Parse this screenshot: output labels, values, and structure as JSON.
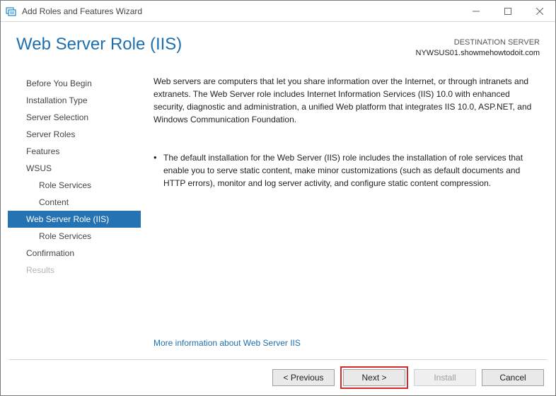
{
  "window": {
    "title": "Add Roles and Features Wizard"
  },
  "header": {
    "title": "Web Server Role (IIS)",
    "destination_label": "DESTINATION SERVER",
    "destination_server": "NYWSUS01.showmehowtodoit.com"
  },
  "nav": {
    "items": [
      {
        "label": "Before You Begin",
        "sub": false,
        "selected": false,
        "disabled": false
      },
      {
        "label": "Installation Type",
        "sub": false,
        "selected": false,
        "disabled": false
      },
      {
        "label": "Server Selection",
        "sub": false,
        "selected": false,
        "disabled": false
      },
      {
        "label": "Server Roles",
        "sub": false,
        "selected": false,
        "disabled": false
      },
      {
        "label": "Features",
        "sub": false,
        "selected": false,
        "disabled": false
      },
      {
        "label": "WSUS",
        "sub": false,
        "selected": false,
        "disabled": false
      },
      {
        "label": "Role Services",
        "sub": true,
        "selected": false,
        "disabled": false
      },
      {
        "label": "Content",
        "sub": true,
        "selected": false,
        "disabled": false
      },
      {
        "label": "Web Server Role (IIS)",
        "sub": false,
        "selected": true,
        "disabled": false
      },
      {
        "label": "Role Services",
        "sub": true,
        "selected": false,
        "disabled": false
      },
      {
        "label": "Confirmation",
        "sub": false,
        "selected": false,
        "disabled": false
      },
      {
        "label": "Results",
        "sub": false,
        "selected": false,
        "disabled": true
      }
    ]
  },
  "content": {
    "intro": "Web servers are computers that let you share information over the Internet, or through intranets and extranets. The Web Server role includes Internet Information Services (IIS) 10.0 with enhanced security, diagnostic and administration, a unified Web platform that integrates IIS 10.0, ASP.NET, and Windows Communication Foundation.",
    "bullet1": "The default installation for the Web Server (IIS) role includes the installation of role services that enable you to serve static content, make minor customizations (such as default documents and HTTP errors), monitor and log server activity, and configure static content compression.",
    "more_link": "More information about Web Server IIS"
  },
  "footer": {
    "previous": "< Previous",
    "next": "Next >",
    "install": "Install",
    "cancel": "Cancel"
  }
}
